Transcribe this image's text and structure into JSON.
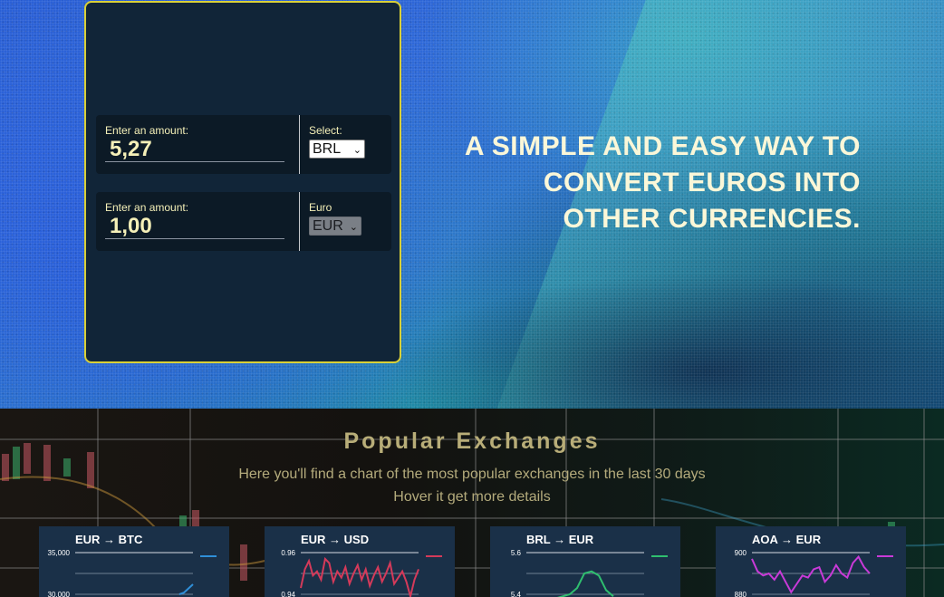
{
  "converter": {
    "row1": {
      "amount_label": "Enter an amount:",
      "amount_value": "5,27",
      "select_label": "Select:",
      "select_value": "BRL"
    },
    "row2": {
      "amount_label": "Enter an amount:",
      "amount_value": "1,00",
      "select_label": "Euro",
      "select_value": "EUR"
    }
  },
  "hero": {
    "headline": [
      "A SIMPLE AND EASY WAY TO",
      "CONVERT EUROS INTO",
      "OTHER CURRENCIES."
    ]
  },
  "popular": {
    "title": "Popular Exchanges",
    "subtitle1": "Here you'll find a chart of the most popular exchanges in the last 30 days",
    "subtitle2": "Hover it get more details"
  },
  "cards": [
    {
      "pair": "EUR → BTC",
      "y_top": "35,000",
      "y_bottom": "30,000",
      "color": "#2f8fd8"
    },
    {
      "pair": "EUR → USD",
      "y_top": "0.96",
      "y_bottom": "0.94",
      "color": "#d43a5a"
    },
    {
      "pair": "BRL → EUR",
      "y_top": "5.6",
      "y_bottom": "5.4",
      "color": "#2fbf6f"
    },
    {
      "pair": "AOA → EUR",
      "y_top": "900",
      "y_bottom": "880",
      "color": "#c93ad8"
    }
  ],
  "chart_data": [
    {
      "type": "line",
      "title": "EUR → BTC",
      "ylim": [
        30000,
        35000
      ],
      "y": [
        30000,
        30200,
        30700,
        31200
      ],
      "yticks": [
        "35,000",
        "30,000"
      ]
    },
    {
      "type": "line",
      "title": "EUR → USD",
      "ylim": [
        0.94,
        0.96
      ],
      "y": [
        0.943,
        0.952,
        0.956,
        0.949,
        0.951,
        0.947,
        0.957,
        0.955,
        0.946,
        0.951,
        0.948,
        0.953,
        0.945,
        0.95,
        0.954,
        0.947,
        0.952,
        0.944,
        0.949,
        0.953,
        0.946,
        0.95,
        0.955,
        0.945,
        0.948,
        0.951,
        0.946,
        0.939,
        0.947,
        0.952
      ],
      "yticks": [
        "0.96",
        "0.94"
      ]
    },
    {
      "type": "line",
      "title": "BRL → EUR",
      "ylim": [
        5.4,
        5.6
      ],
      "y": [
        5.38,
        5.39,
        5.4,
        5.43,
        5.5,
        5.51,
        5.49,
        5.42,
        5.39
      ],
      "yticks": [
        "5.6",
        "5.4"
      ]
    },
    {
      "type": "line",
      "title": "AOA → EUR",
      "ylim": [
        880,
        900
      ],
      "y": [
        897,
        891,
        889,
        890,
        887,
        891,
        886,
        881,
        885,
        889,
        888,
        892,
        893,
        886,
        889,
        894,
        890,
        888,
        895,
        898,
        893,
        890
      ],
      "yticks": [
        "900",
        "880"
      ]
    }
  ]
}
